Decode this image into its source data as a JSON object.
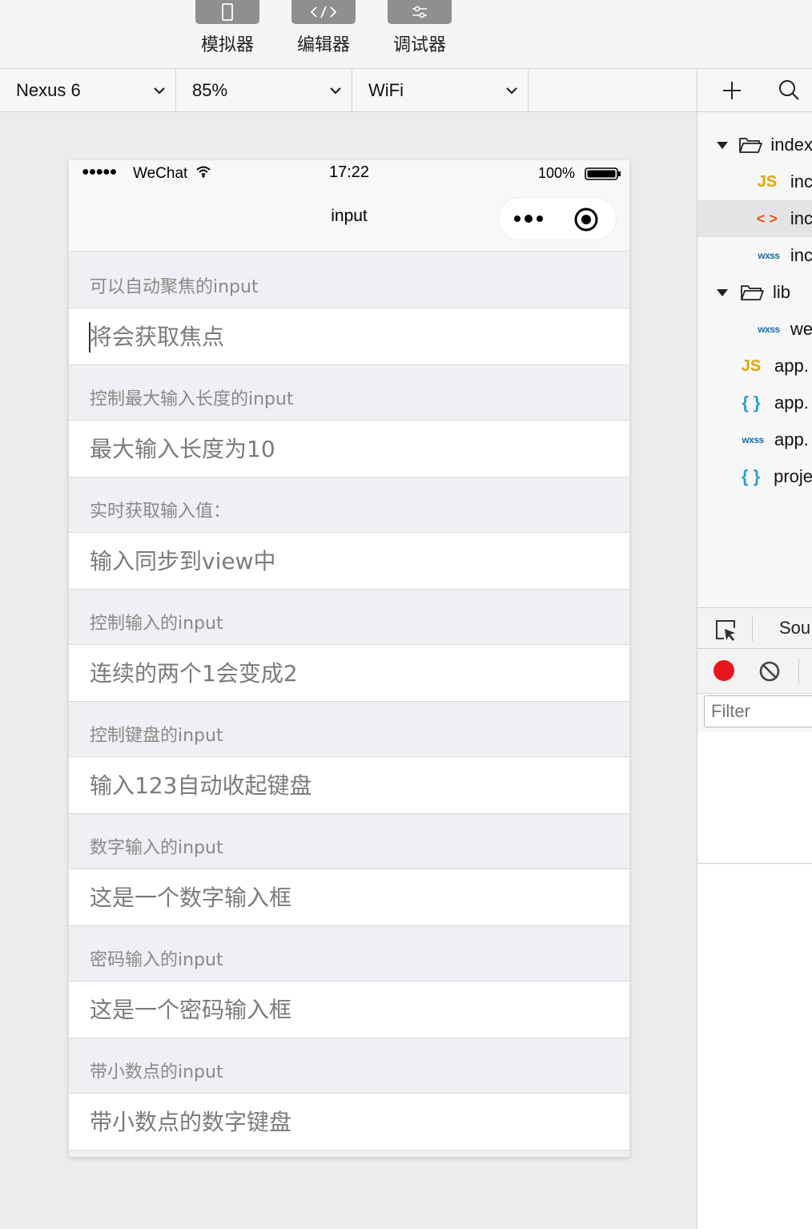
{
  "toolbar": {
    "simulator_label": "模拟器",
    "editor_label": "编辑器",
    "debugger_label": "调试器"
  },
  "devbar": {
    "device": "Nexus 6",
    "zoom": "85%",
    "network": "WiFi"
  },
  "phone": {
    "status": {
      "carrier": "WeChat",
      "time": "17:22",
      "battery": "100%"
    },
    "nav_title": "input",
    "sections": [
      {
        "header": "可以自动聚焦的input",
        "placeholder": "将会获取焦点"
      },
      {
        "header": "控制最大输入长度的input",
        "placeholder": "最大输入长度为10"
      },
      {
        "header": "实时获取输入值：",
        "placeholder": "输入同步到view中"
      },
      {
        "header": "控制输入的input",
        "placeholder": "连续的两个1会变成2"
      },
      {
        "header": "控制键盘的input",
        "placeholder": "输入123自动收起键盘"
      },
      {
        "header": "数字输入的input",
        "placeholder": "这是一个数字输入框"
      },
      {
        "header": "密码输入的input",
        "placeholder": "这是一个密码输入框"
      },
      {
        "header": "带小数点的input",
        "placeholder": "带小数点的数字键盘"
      }
    ]
  },
  "file_tree": [
    {
      "icon": "folder-icon",
      "label": "index",
      "indent": 1,
      "expanded": true
    },
    {
      "icon": "js-icon",
      "label": "inc",
      "indent": 2
    },
    {
      "icon": "wxml-icon",
      "label": "inc",
      "indent": 2,
      "selected": true
    },
    {
      "icon": "wxss-icon",
      "label": "inc",
      "indent": 2
    },
    {
      "icon": "folder-icon",
      "label": "lib",
      "indent": 1,
      "expanded": true
    },
    {
      "icon": "wxss-icon",
      "label": "we",
      "indent": 2
    },
    {
      "icon": "js-icon",
      "label": "app.",
      "indent": 0
    },
    {
      "icon": "json-icon",
      "label": "app.",
      "indent": 0
    },
    {
      "icon": "wxss-icon",
      "label": "app.",
      "indent": 0
    },
    {
      "icon": "json-icon",
      "label": "proje",
      "indent": 0
    }
  ],
  "icon_glyphs": {
    "js": "JS",
    "wxml": "< >",
    "wxss": "wxss",
    "json": "{ }"
  },
  "debugger": {
    "tab_sources": "Sou",
    "filter_placeholder": "Filter"
  },
  "colors": {
    "record_red": "#e8141e",
    "js_yellow": "#e6a400",
    "wxml_orange": "#e5561b",
    "wxss_blue": "#1c6ea4",
    "json_cyan": "#2aa0d0"
  }
}
